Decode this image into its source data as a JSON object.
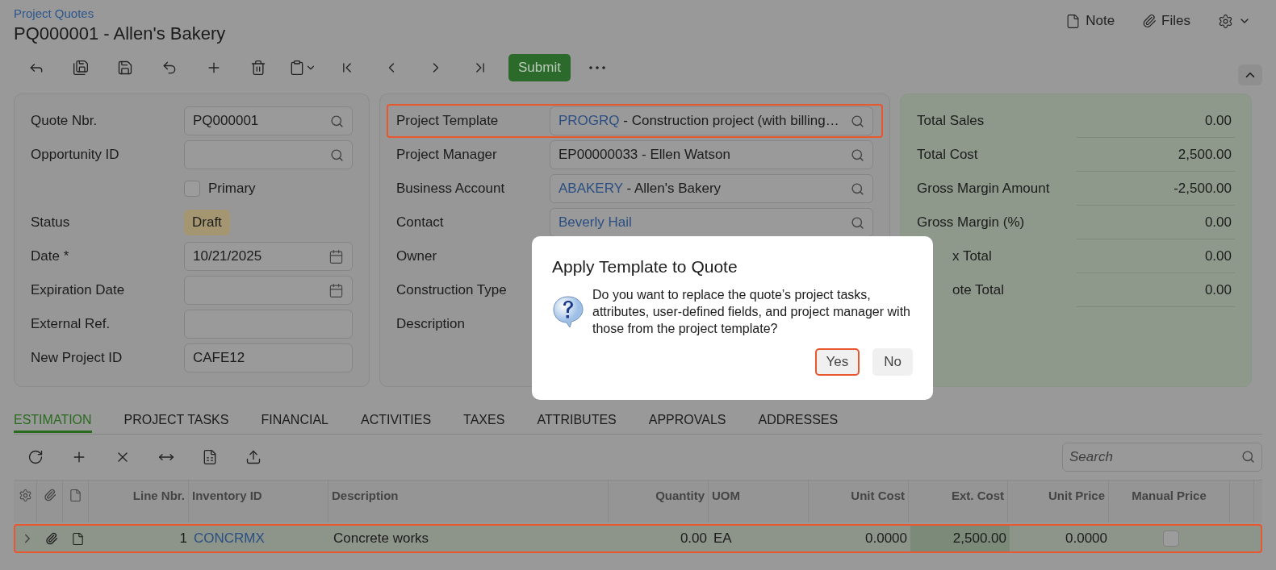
{
  "breadcrumb": "Project Quotes",
  "title": "PQ000001 - Allen's Bakery",
  "header_actions": [
    {
      "kind": "note",
      "label": "Note"
    },
    {
      "kind": "files",
      "label": "Files"
    },
    {
      "kind": "settings"
    }
  ],
  "toolbar": [
    {
      "kind": "back"
    },
    {
      "kind": "save-close"
    },
    {
      "kind": "save"
    },
    {
      "kind": "undo"
    },
    {
      "kind": "add"
    },
    {
      "kind": "delete"
    },
    {
      "kind": "clipboard"
    },
    {
      "kind": "first"
    },
    {
      "kind": "prev"
    },
    {
      "kind": "next"
    },
    {
      "kind": "last"
    },
    {
      "kind": "submit",
      "label": "Submit"
    },
    {
      "kind": "more"
    }
  ],
  "quote_fields": [
    {
      "kind": "lookup",
      "label": "Quote Nbr.",
      "value": "PQ000001"
    },
    {
      "kind": "lookup",
      "label": "Opportunity ID"
    },
    {
      "kind": "checkbox",
      "label": "Primary",
      "checked": false
    },
    {
      "kind": "badge",
      "label": "Status",
      "value": "Draft"
    },
    {
      "kind": "date",
      "label": "Date *",
      "value": "10/21/2025"
    },
    {
      "kind": "date",
      "label": "Expiration Date"
    },
    {
      "kind": "text",
      "label": "External Ref."
    },
    {
      "kind": "text",
      "label": "New Project ID",
      "value": "CAFE12"
    }
  ],
  "project_fields": [
    {
      "kind": "lookup",
      "label": "Project Template",
      "code": "PROGRQ",
      "value": "- Construction project (with billing…",
      "highlighted": true
    },
    {
      "kind": "lookup",
      "label": "Project Manager",
      "value": "EP00000033 - Ellen Watson",
      "highlighted": false
    },
    {
      "kind": "lookup",
      "label": "Business Account",
      "code": "ABAKERY",
      "value": "- Allen's Bakery",
      "highlighted": false
    },
    {
      "kind": "lookup",
      "label": "Contact",
      "code": "Beverly Hail",
      "highlighted": false
    },
    {
      "kind": "covered",
      "label": "Owner"
    },
    {
      "kind": "covered",
      "label": "Construction Type"
    },
    {
      "kind": "covered",
      "label": "Description"
    }
  ],
  "totals": [
    {
      "label": "Total Sales",
      "value": "0.00",
      "covered": false
    },
    {
      "label": "Total Cost",
      "value": "2,500.00",
      "covered": false
    },
    {
      "label": "Gross Margin Amount",
      "value": "-2,500.00",
      "covered": false
    },
    {
      "label": "Gross Margin (%)",
      "value": "0.00",
      "covered": false
    },
    {
      "label": "x Total",
      "value": "0.00",
      "covered": true
    },
    {
      "label": "ote Total",
      "value": "0.00",
      "covered": true
    }
  ],
  "dialog": {
    "title": "Apply Template to Quote",
    "message": "Do you want to replace the quote’s project tasks, attributes, user-defined fields, and project manager with those from the project template?",
    "buttons": [
      {
        "label": "Yes",
        "focused": true
      },
      {
        "label": "No",
        "focused": false
      }
    ]
  },
  "tabs": [
    {
      "label": "ESTIMATION",
      "selected": true
    },
    {
      "label": "PROJECT TASKS",
      "selected": false
    },
    {
      "label": "FINANCIAL",
      "selected": false
    },
    {
      "label": "ACTIVITIES",
      "selected": false
    },
    {
      "label": "TAXES",
      "selected": false
    },
    {
      "label": "ATTRIBUTES",
      "selected": false
    },
    {
      "label": "APPROVALS",
      "selected": false
    },
    {
      "label": "ADDRESSES",
      "selected": false
    }
  ],
  "grid": {
    "toolbar": [
      {
        "kind": "refresh"
      },
      {
        "kind": "add"
      },
      {
        "kind": "delete"
      },
      {
        "kind": "fit"
      },
      {
        "kind": "excel"
      },
      {
        "kind": "upload"
      }
    ],
    "search": {
      "placeholder": "Search"
    },
    "columns": [
      {
        "kind": "settings"
      },
      {
        "kind": "files"
      },
      {
        "kind": "note"
      },
      {
        "kind": "numeric",
        "label": "Line Nbr."
      },
      {
        "kind": "textual",
        "label": "Inventory ID"
      },
      {
        "kind": "textual",
        "label": "Description"
      },
      {
        "kind": "numeric",
        "label": "Quantity"
      },
      {
        "kind": "textual",
        "label": "UOM"
      },
      {
        "kind": "numeric",
        "label": "Unit Cost"
      },
      {
        "kind": "numeric",
        "label": "Ext. Cost"
      },
      {
        "kind": "numeric",
        "label": "Unit Price"
      },
      {
        "kind": "check",
        "label": "Manual Price"
      },
      {
        "kind": "blank"
      }
    ],
    "rows": [
      {
        "highlighted": true,
        "cells": [
          {
            "kind": "expand"
          },
          {
            "kind": "files"
          },
          {
            "kind": "note"
          },
          {
            "kind": "number",
            "text": "1"
          },
          {
            "kind": "link",
            "text": "CONCRMX"
          },
          {
            "kind": "text",
            "text": "Concrete works"
          },
          {
            "kind": "number",
            "text": "0.00"
          },
          {
            "kind": "text",
            "text": "EA"
          },
          {
            "kind": "number",
            "text": "0.0000"
          },
          {
            "kind": "total",
            "text": "2,500.00"
          },
          {
            "kind": "number",
            "text": "0.0000"
          },
          {
            "kind": "checkbox",
            "checked": false
          },
          {
            "kind": "blank"
          }
        ]
      }
    ]
  }
}
